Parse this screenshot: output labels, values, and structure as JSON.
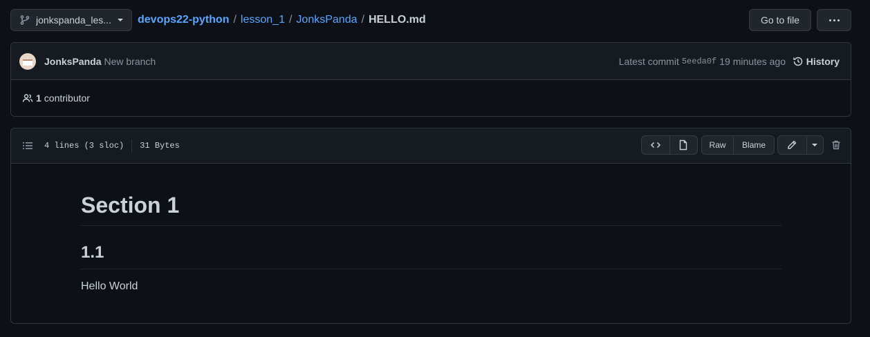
{
  "header": {
    "branch_label": "jonkspanda_les...",
    "breadcrumb": {
      "repo": "devops22-python",
      "folder1": "lesson_1",
      "folder2": "JonksPanda",
      "file": "HELLO.md"
    },
    "go_to_file_label": "Go to file"
  },
  "commit": {
    "author": "JonksPanda",
    "message": "New branch",
    "latest_label": "Latest commit",
    "sha": "5eeda0f",
    "time_ago": "19 minutes ago",
    "history_label": "History",
    "contributor_count": "1",
    "contributor_label": "contributor"
  },
  "file": {
    "lines_info": "4 lines (3 sloc)",
    "size": "31 Bytes",
    "raw_label": "Raw",
    "blame_label": "Blame"
  },
  "content": {
    "h1": "Section 1",
    "h2": "1.1",
    "paragraph": "Hello World"
  },
  "colors": {
    "background": "#0d1117",
    "panel": "#161b22",
    "border": "#30363d",
    "link": "#58a6ff",
    "text": "#c9d1d9",
    "muted": "#8b949e"
  }
}
